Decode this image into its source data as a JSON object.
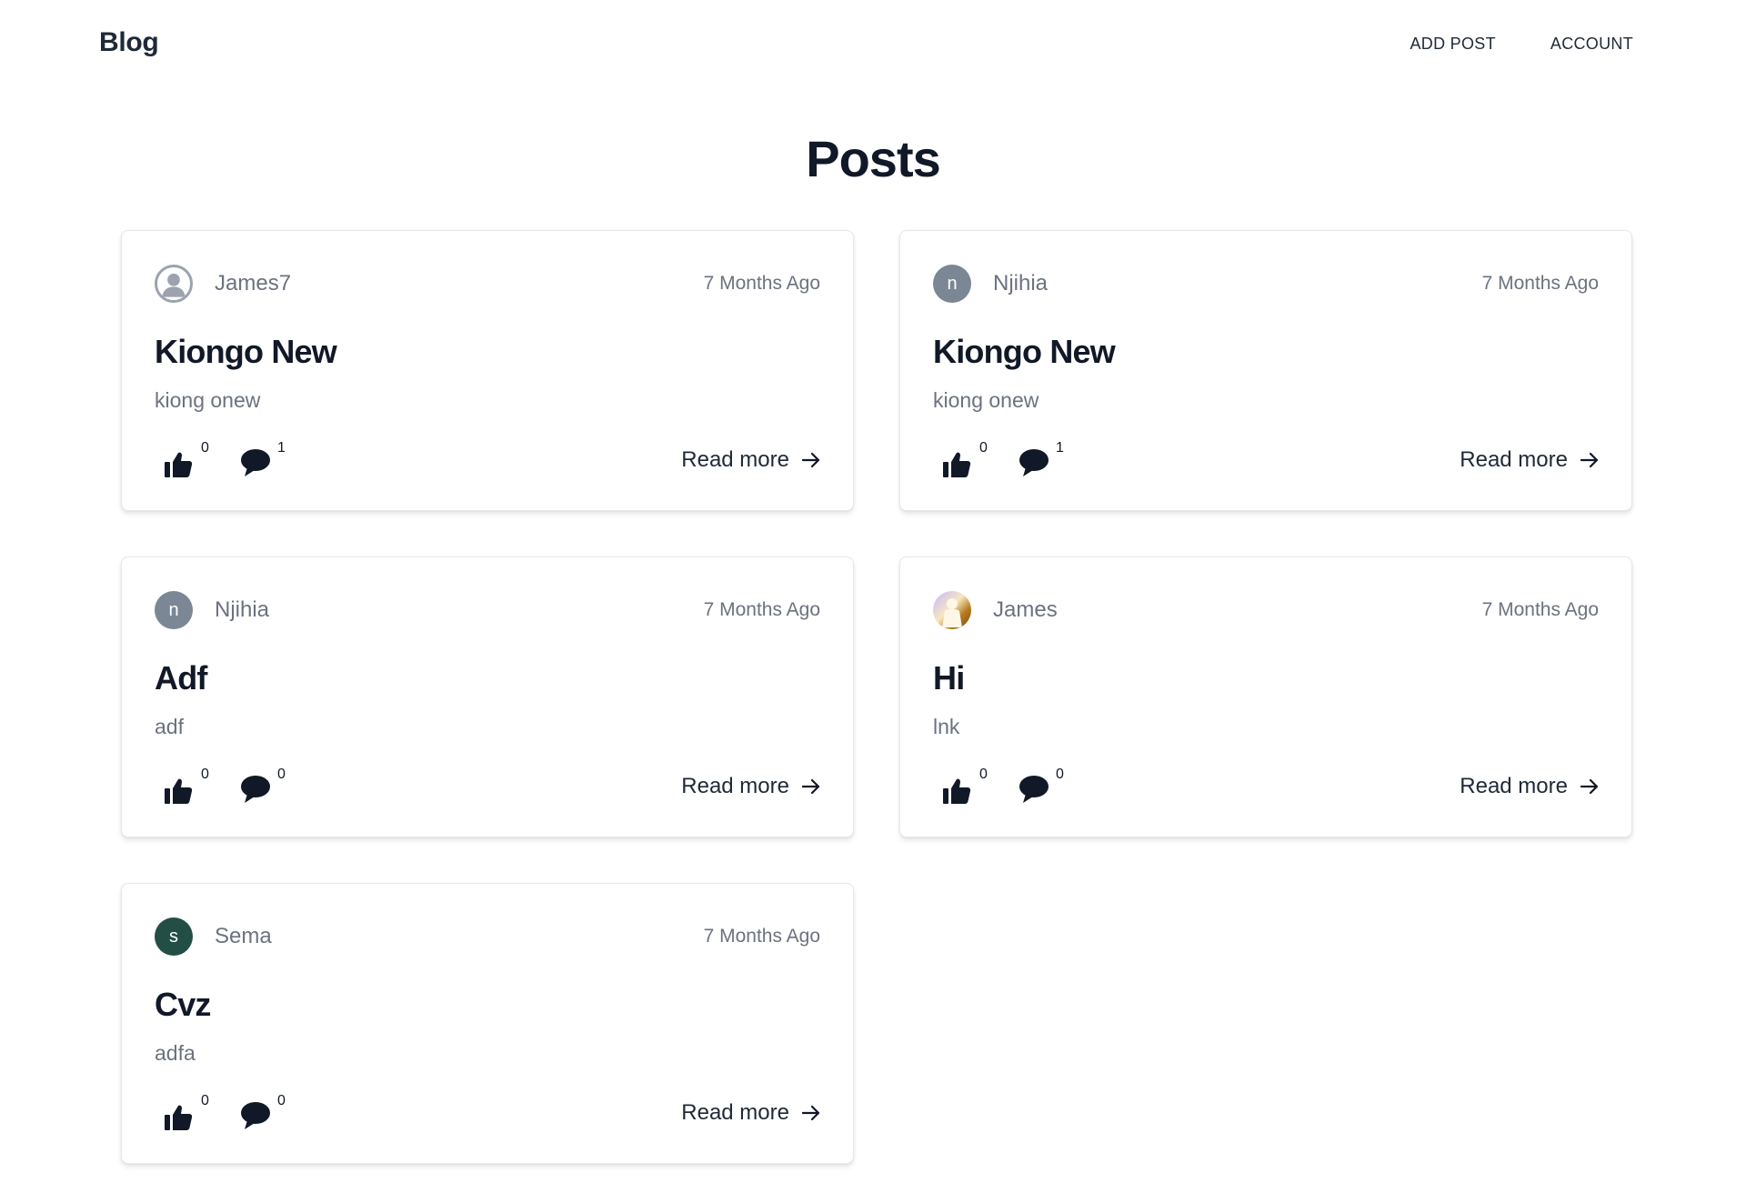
{
  "nav": {
    "brand": "Blog",
    "links": [
      "ADD POST",
      "ACCOUNT"
    ]
  },
  "page": {
    "title": "Posts"
  },
  "read_more_label": "Read more",
  "posts": [
    {
      "author": "James7",
      "avatar": {
        "type": "default-user-icon",
        "letter": "",
        "color": "#9ca3af"
      },
      "time": "7 Months Ago",
      "title": "Kiongo New",
      "excerpt": "kiong onew",
      "likes": "0",
      "comments": "1"
    },
    {
      "author": "Njihia",
      "avatar": {
        "type": "letter",
        "letter": "n",
        "color": "#7b8794"
      },
      "time": "7 Months Ago",
      "title": "Kiongo New",
      "excerpt": "kiong onew",
      "likes": "0",
      "comments": "1"
    },
    {
      "author": "Njihia",
      "avatar": {
        "type": "letter",
        "letter": "n",
        "color": "#7b8794"
      },
      "time": "7 Months Ago",
      "title": "Adf",
      "excerpt": "adf",
      "likes": "0",
      "comments": "0"
    },
    {
      "author": "James",
      "avatar": {
        "type": "photo",
        "letter": "",
        "color": "#b7791f"
      },
      "time": "7 Months Ago",
      "title": "Hi",
      "excerpt": "lnk",
      "likes": "0",
      "comments": "0"
    },
    {
      "author": "Sema",
      "avatar": {
        "type": "letter",
        "letter": "s",
        "color": "#234e46"
      },
      "time": "7 Months Ago",
      "title": "Cvz",
      "excerpt": "adfa",
      "likes": "0",
      "comments": "0"
    }
  ]
}
